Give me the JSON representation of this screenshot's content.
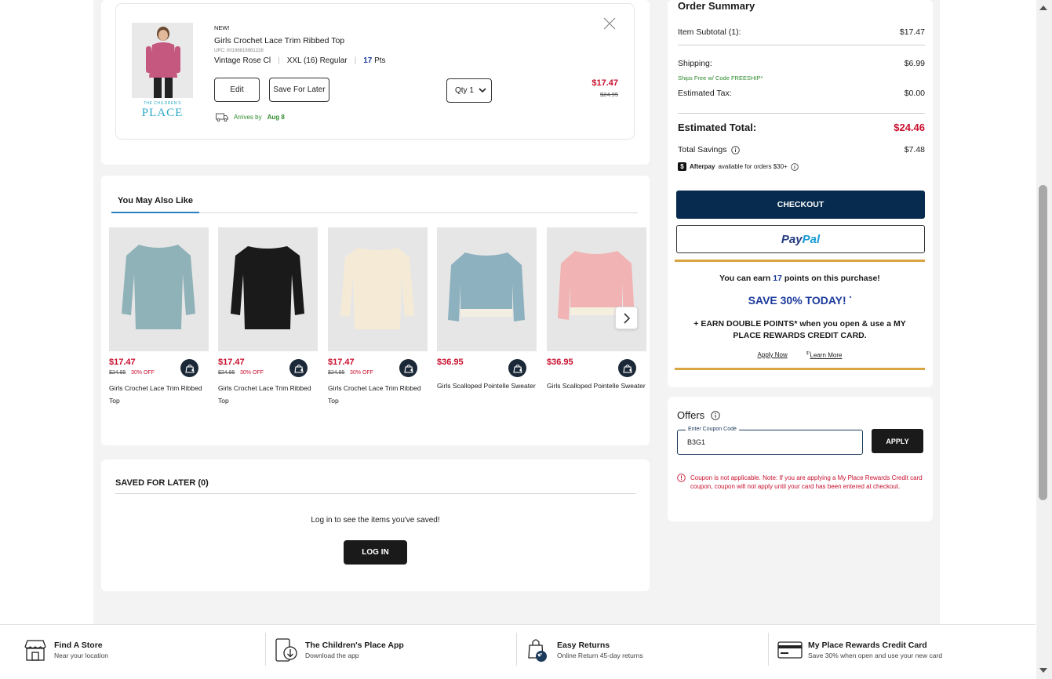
{
  "cart_item": {
    "badge": "NEW!",
    "name": "Girls Crochet Lace Trim Ribbed Top",
    "upc": "UPC: 00198818981228",
    "color": "Vintage Rose Cl",
    "size": "XXL (16) Regular",
    "points_value": "17",
    "points_label": "Pts",
    "edit_label": "Edit",
    "save_later_label": "Save For Later",
    "qty_label": "Qty 1",
    "price": "$17.47",
    "was_price": "$24.95",
    "arrives_label": "Arrives by",
    "arrives_date": "Aug 8",
    "brand_small": "THE CHILDREN'S",
    "brand_big": "PLACE"
  },
  "ymal": {
    "title": "You May Also Like",
    "products": [
      {
        "price": "$17.47",
        "was": "$24.95",
        "off": "30% OFF",
        "name": "Girls Crochet Lace Trim Ribbed Top",
        "color": "#8fb2b8"
      },
      {
        "price": "$17.47",
        "was": "$24.95",
        "off": "30% OFF",
        "name": "Girls Crochet Lace Trim Ribbed Top",
        "color": "#1a1a1a"
      },
      {
        "price": "$17.47",
        "was": "$24.95",
        "off": "30% OFF",
        "name": "Girls Crochet Lace Trim Ribbed Top",
        "color": "#f5ead6"
      },
      {
        "price": "$36.95",
        "was": "",
        "off": "",
        "name": "Girls Scalloped Pointelle Sweater",
        "color": "#8db1bf"
      },
      {
        "price": "$36.95",
        "was": "",
        "off": "",
        "name": "Girls Scalloped Pointelle Sweater",
        "color": "#f1b3b3"
      }
    ]
  },
  "saved": {
    "title": "SAVED FOR LATER (0)",
    "message": "Log in to see the items you've saved!",
    "login_label": "LOG IN"
  },
  "summary": {
    "title": "Order Summary",
    "subtotal_label": "Item Subtotal (1):",
    "subtotal_value": "$17.47",
    "shipping_label": "Shipping:",
    "shipping_value": "$6.99",
    "ship_free_note": "Ships Free w/ Code FREESHIP*",
    "tax_label": "Estimated Tax:",
    "tax_value": "$0.00",
    "total_label": "Estimated Total:",
    "total_value": "$24.46",
    "savings_label": "Total Savings",
    "savings_value": "$7.48",
    "afterpay_brand": "Afterpay",
    "afterpay_text": "available for orders $30+",
    "checkout_label": "CHECKOUT",
    "paypal_a": "Pay",
    "paypal_b": "Pal",
    "earn_pre": "You can earn",
    "earn_points": "17",
    "earn_post": "points on this purchase!",
    "save_today": "SAVE 30% TODAY!",
    "save_mark": "*",
    "double_points": "+ EARN DOUBLE POINTS* when you open & use a MY PLACE REWARDS CREDIT CARD.",
    "apply_now": "Apply Now",
    "learn_mark": "$*",
    "learn_more": "Learn More"
  },
  "offers": {
    "title": "Offers",
    "coupon_label": "Enter Coupon Code",
    "coupon_value": "B3G1",
    "apply_label": "APPLY",
    "error": "Coupon is not applicable. Note: If you are applying a My Place Rewards Credit card coupon, coupon will not apply until your card has been entered at checkout."
  },
  "footer": [
    {
      "title": "Find A Store",
      "sub": "Near your location",
      "icon": "store-icon"
    },
    {
      "title": "The Children's Place App",
      "sub": "Download the app",
      "icon": "phone-app-icon"
    },
    {
      "title": "Easy Returns",
      "sub": "Online Return 45-day returns",
      "icon": "returns-bag-icon"
    },
    {
      "title": "My Place Rewards Credit Card",
      "sub": "Save 30% when open and use your new card",
      "icon": "credit-card-icon"
    }
  ],
  "colors": {
    "accent_red": "#c8102e",
    "navy": "#072b4e",
    "green": "#2e8b2e",
    "gold": "#d9a441",
    "points_blue": "#1b3a9c"
  }
}
